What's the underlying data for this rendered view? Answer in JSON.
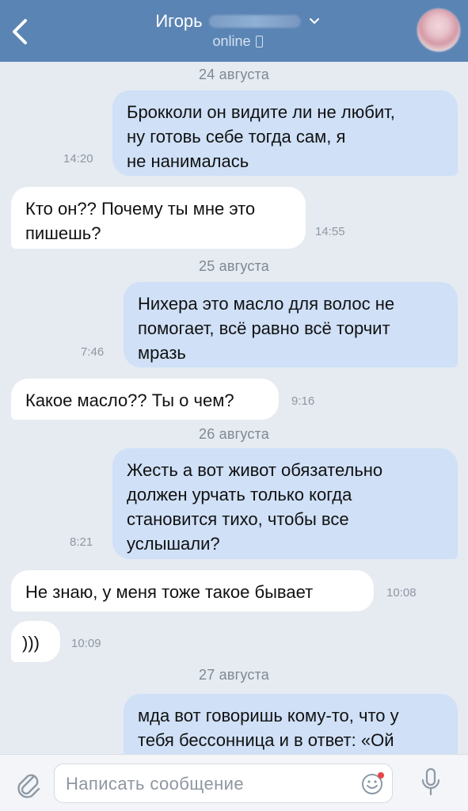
{
  "header": {
    "contact_name": "Игорь",
    "status": "online",
    "colors": {
      "bar": "#5a84b4",
      "text": "#ffffff"
    }
  },
  "messages": [
    {
      "type": "date",
      "text": "24 августа"
    },
    {
      "type": "outgoing",
      "text": "Брокколи он видите ли не любит,\nну готовь себе тогда сам, я\nне нанималась",
      "time": "14:20"
    },
    {
      "type": "incoming",
      "text": "Кто он?? Почему ты мне это\nпишешь?",
      "time": "14:55"
    },
    {
      "type": "date",
      "text": "25 августа"
    },
    {
      "type": "outgoing",
      "text": "Нихера это масло для волос не\nпомогает,  всё равно всё торчит\nмразь",
      "time": "7:46"
    },
    {
      "type": "incoming",
      "text": "Какое масло?? Ты о чем?",
      "time": "9:16"
    },
    {
      "type": "date",
      "text": "26 августа"
    },
    {
      "type": "outgoing",
      "text": "Жесть а вот живот обязательно\nдолжен урчать только когда\nстановится тихо, чтобы все\nуслышали?",
      "time": "8:21"
    },
    {
      "type": "incoming",
      "text": "Не знаю, у меня тоже такое бывает",
      "time": "10:08"
    },
    {
      "type": "incoming",
      "text": ")))",
      "time": "10:09"
    },
    {
      "type": "date",
      "text": "27 августа"
    },
    {
      "type": "outgoing",
      "text": "мда вот говоришь кому-то, что у\nтебя бессонница и в ответ: «Ой"
    }
  ],
  "composer": {
    "placeholder": "Написать сообщение",
    "icons": [
      "paperclip-icon",
      "smile-icon",
      "microphone-icon"
    ]
  },
  "colors": {
    "background": "#e6ebf1",
    "outgoing_bubble": "#cfe0f7",
    "incoming_bubble": "#ffffff",
    "accent": "#5a84b4"
  }
}
